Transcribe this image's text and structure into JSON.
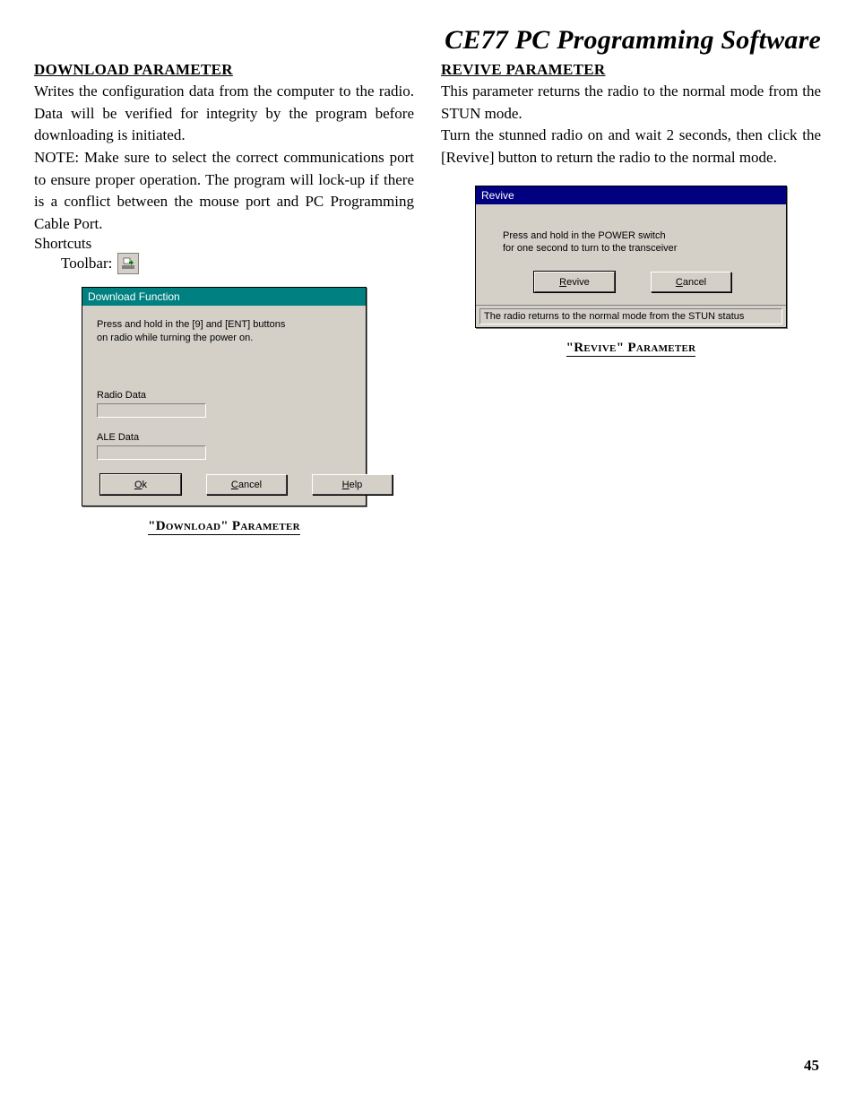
{
  "page": {
    "title": "CE77 PC Programming Software",
    "number": "45"
  },
  "left": {
    "heading": "DOWNLOAD PARAMETER",
    "para1": "Writes the configuration data from the computer to the radio. Data will be verified for integrity by the program before downloading is initiated.",
    "para2": "NOTE: Make sure to select the correct communications port to ensure proper operation. The program will lock-up if there is a conflict between the mouse port and PC Programming Cable Port.",
    "shortcuts": "Shortcuts",
    "toolbar_label": "Toolbar:",
    "dialog": {
      "title": "Download Function",
      "instruction_l1": "Press and hold in the [9] and [ENT] buttons",
      "instruction_l2": "on radio while turning the power on.",
      "field1": "Radio Data",
      "field2": "ALE Data",
      "btn_ok": "Ok",
      "btn_cancel": "Cancel",
      "btn_help": "Help"
    },
    "caption": "\"Download\" Parameter"
  },
  "right": {
    "heading": "REVIVE PARAMETER",
    "para1": "This parameter returns the radio to the normal mode from the STUN mode.",
    "para2": "Turn the stunned radio on and wait 2 seconds, then click the [Revive] button to return the radio to the normal mode.",
    "dialog": {
      "title": "Revive",
      "instruction_l1": "Press and hold in the POWER switch",
      "instruction_l2": "for one second to turn to the transceiver",
      "btn_revive": "Revive",
      "btn_cancel": "Cancel",
      "status": "The radio returns to the normal mode from the STUN status"
    },
    "caption": "\"Revive\" Parameter"
  }
}
